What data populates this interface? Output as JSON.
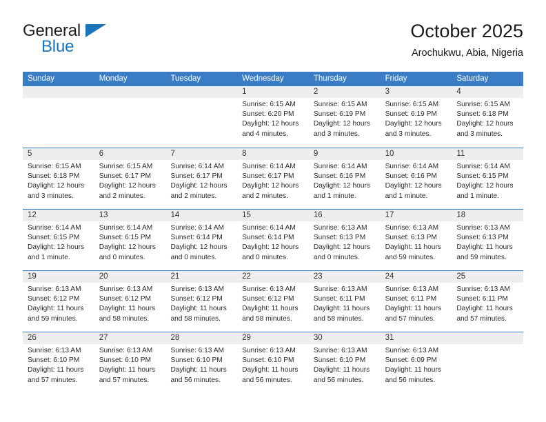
{
  "brand": {
    "name_top": "General",
    "name_bottom": "Blue",
    "triangle_color": "#1b75bb"
  },
  "header": {
    "title": "October 2025",
    "subtitle": "Arochukwu, Abia, Nigeria"
  },
  "theme": {
    "header_blue": "#3b7dc4",
    "day_number_band": "#eeeeee",
    "text": "#2b2b2b"
  },
  "weekday_headers": [
    "Sunday",
    "Monday",
    "Tuesday",
    "Wednesday",
    "Thursday",
    "Friday",
    "Saturday"
  ],
  "labels": {
    "sunrise": "Sunrise:",
    "sunset": "Sunset:",
    "daylight": "Daylight:"
  },
  "weeks": [
    [
      {
        "empty": true
      },
      {
        "empty": true
      },
      {
        "empty": true
      },
      {
        "day": "1",
        "sunrise": "Sunrise: 6:15 AM",
        "sunset": "Sunset: 6:20 PM",
        "daylight": "Daylight: 12 hours and 4 minutes."
      },
      {
        "day": "2",
        "sunrise": "Sunrise: 6:15 AM",
        "sunset": "Sunset: 6:19 PM",
        "daylight": "Daylight: 12 hours and 3 minutes."
      },
      {
        "day": "3",
        "sunrise": "Sunrise: 6:15 AM",
        "sunset": "Sunset: 6:19 PM",
        "daylight": "Daylight: 12 hours and 3 minutes."
      },
      {
        "day": "4",
        "sunrise": "Sunrise: 6:15 AM",
        "sunset": "Sunset: 6:18 PM",
        "daylight": "Daylight: 12 hours and 3 minutes."
      }
    ],
    [
      {
        "day": "5",
        "sunrise": "Sunrise: 6:15 AM",
        "sunset": "Sunset: 6:18 PM",
        "daylight": "Daylight: 12 hours and 3 minutes."
      },
      {
        "day": "6",
        "sunrise": "Sunrise: 6:15 AM",
        "sunset": "Sunset: 6:17 PM",
        "daylight": "Daylight: 12 hours and 2 minutes."
      },
      {
        "day": "7",
        "sunrise": "Sunrise: 6:14 AM",
        "sunset": "Sunset: 6:17 PM",
        "daylight": "Daylight: 12 hours and 2 minutes."
      },
      {
        "day": "8",
        "sunrise": "Sunrise: 6:14 AM",
        "sunset": "Sunset: 6:17 PM",
        "daylight": "Daylight: 12 hours and 2 minutes."
      },
      {
        "day": "9",
        "sunrise": "Sunrise: 6:14 AM",
        "sunset": "Sunset: 6:16 PM",
        "daylight": "Daylight: 12 hours and 1 minute."
      },
      {
        "day": "10",
        "sunrise": "Sunrise: 6:14 AM",
        "sunset": "Sunset: 6:16 PM",
        "daylight": "Daylight: 12 hours and 1 minute."
      },
      {
        "day": "11",
        "sunrise": "Sunrise: 6:14 AM",
        "sunset": "Sunset: 6:15 PM",
        "daylight": "Daylight: 12 hours and 1 minute."
      }
    ],
    [
      {
        "day": "12",
        "sunrise": "Sunrise: 6:14 AM",
        "sunset": "Sunset: 6:15 PM",
        "daylight": "Daylight: 12 hours and 1 minute."
      },
      {
        "day": "13",
        "sunrise": "Sunrise: 6:14 AM",
        "sunset": "Sunset: 6:15 PM",
        "daylight": "Daylight: 12 hours and 0 minutes."
      },
      {
        "day": "14",
        "sunrise": "Sunrise: 6:14 AM",
        "sunset": "Sunset: 6:14 PM",
        "daylight": "Daylight: 12 hours and 0 minutes."
      },
      {
        "day": "15",
        "sunrise": "Sunrise: 6:14 AM",
        "sunset": "Sunset: 6:14 PM",
        "daylight": "Daylight: 12 hours and 0 minutes."
      },
      {
        "day": "16",
        "sunrise": "Sunrise: 6:13 AM",
        "sunset": "Sunset: 6:13 PM",
        "daylight": "Daylight: 12 hours and 0 minutes."
      },
      {
        "day": "17",
        "sunrise": "Sunrise: 6:13 AM",
        "sunset": "Sunset: 6:13 PM",
        "daylight": "Daylight: 11 hours and 59 minutes."
      },
      {
        "day": "18",
        "sunrise": "Sunrise: 6:13 AM",
        "sunset": "Sunset: 6:13 PM",
        "daylight": "Daylight: 11 hours and 59 minutes."
      }
    ],
    [
      {
        "day": "19",
        "sunrise": "Sunrise: 6:13 AM",
        "sunset": "Sunset: 6:12 PM",
        "daylight": "Daylight: 11 hours and 59 minutes."
      },
      {
        "day": "20",
        "sunrise": "Sunrise: 6:13 AM",
        "sunset": "Sunset: 6:12 PM",
        "daylight": "Daylight: 11 hours and 58 minutes."
      },
      {
        "day": "21",
        "sunrise": "Sunrise: 6:13 AM",
        "sunset": "Sunset: 6:12 PM",
        "daylight": "Daylight: 11 hours and 58 minutes."
      },
      {
        "day": "22",
        "sunrise": "Sunrise: 6:13 AM",
        "sunset": "Sunset: 6:12 PM",
        "daylight": "Daylight: 11 hours and 58 minutes."
      },
      {
        "day": "23",
        "sunrise": "Sunrise: 6:13 AM",
        "sunset": "Sunset: 6:11 PM",
        "daylight": "Daylight: 11 hours and 58 minutes."
      },
      {
        "day": "24",
        "sunrise": "Sunrise: 6:13 AM",
        "sunset": "Sunset: 6:11 PM",
        "daylight": "Daylight: 11 hours and 57 minutes."
      },
      {
        "day": "25",
        "sunrise": "Sunrise: 6:13 AM",
        "sunset": "Sunset: 6:11 PM",
        "daylight": "Daylight: 11 hours and 57 minutes."
      }
    ],
    [
      {
        "day": "26",
        "sunrise": "Sunrise: 6:13 AM",
        "sunset": "Sunset: 6:10 PM",
        "daylight": "Daylight: 11 hours and 57 minutes."
      },
      {
        "day": "27",
        "sunrise": "Sunrise: 6:13 AM",
        "sunset": "Sunset: 6:10 PM",
        "daylight": "Daylight: 11 hours and 57 minutes."
      },
      {
        "day": "28",
        "sunrise": "Sunrise: 6:13 AM",
        "sunset": "Sunset: 6:10 PM",
        "daylight": "Daylight: 11 hours and 56 minutes."
      },
      {
        "day": "29",
        "sunrise": "Sunrise: 6:13 AM",
        "sunset": "Sunset: 6:10 PM",
        "daylight": "Daylight: 11 hours and 56 minutes."
      },
      {
        "day": "30",
        "sunrise": "Sunrise: 6:13 AM",
        "sunset": "Sunset: 6:10 PM",
        "daylight": "Daylight: 11 hours and 56 minutes."
      },
      {
        "day": "31",
        "sunrise": "Sunrise: 6:13 AM",
        "sunset": "Sunset: 6:09 PM",
        "daylight": "Daylight: 11 hours and 56 minutes."
      },
      {
        "empty": true
      }
    ]
  ]
}
